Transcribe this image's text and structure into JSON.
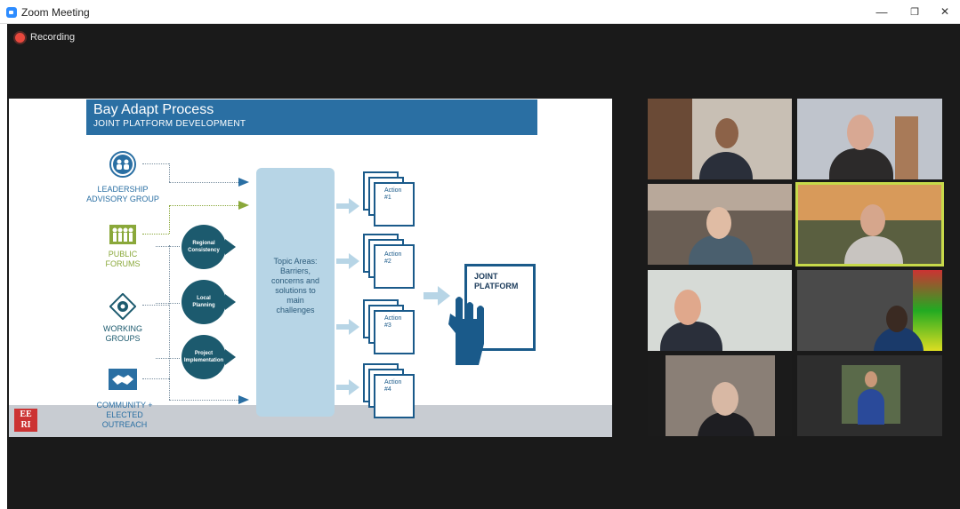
{
  "window": {
    "title": "Zoom Meeting",
    "minimize": "—",
    "restore": "❐",
    "close": "✕"
  },
  "recording": {
    "label": "Recording"
  },
  "slide": {
    "title": "Bay Adapt Process",
    "subtitle": "JOINT PLATFORM DEVELOPMENT",
    "groups": [
      {
        "lines": [
          "LEADERSHIP",
          "ADVISORY GROUP"
        ],
        "color": "#2a6fa3"
      },
      {
        "lines": [
          "PUBLIC",
          "FORUMS"
        ],
        "color": "#8aa83a"
      },
      {
        "lines": [
          "WORKING",
          "GROUPS"
        ],
        "color": "#1c5a6e"
      },
      {
        "lines": [
          "COMMUNITY +",
          "ELECTED",
          "OUTREACH"
        ],
        "color": "#2a6fa3"
      }
    ],
    "circles": [
      {
        "lines": [
          "Regional",
          "Consistency"
        ]
      },
      {
        "lines": [
          "Local",
          "Planning"
        ]
      },
      {
        "lines": [
          "Project",
          "Implementation"
        ]
      }
    ],
    "topic": {
      "lines": [
        "Topic Areas:",
        "Barriers,",
        "concerns and",
        "solutions to",
        "main",
        "challenges"
      ]
    },
    "actions": [
      {
        "label": "Action",
        "num": "#1"
      },
      {
        "label": "Action",
        "num": "#2"
      },
      {
        "label": "Action",
        "num": "#3"
      },
      {
        "label": "Action",
        "num": "#4"
      }
    ],
    "joint": {
      "lines": [
        "JOINT",
        "PLATFORM"
      ]
    },
    "logo": {
      "lines": [
        "EE",
        "RI"
      ]
    }
  },
  "colors": {
    "zoom_blue": "#2D8CFF",
    "recording_red": "#e8483d",
    "active_speaker": "#c7d94a",
    "slide_blue": "#2a6fa3"
  }
}
